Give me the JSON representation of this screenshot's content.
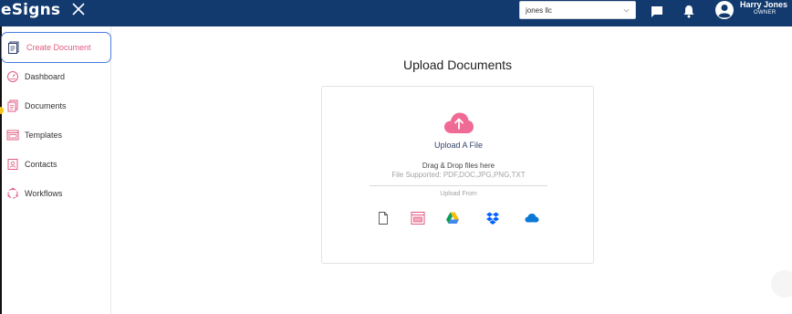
{
  "header": {
    "logo": "eSigns",
    "company": "jones llc",
    "user_name": "Harry Jones",
    "user_role": "OWNER"
  },
  "sidebar": {
    "items": [
      {
        "label": "Create Document",
        "icon": "create-document-icon",
        "active": true
      },
      {
        "label": "Dashboard",
        "icon": "dashboard-icon"
      },
      {
        "label": "Documents",
        "icon": "documents-icon"
      },
      {
        "label": "Templates",
        "icon": "templates-icon"
      },
      {
        "label": "Contacts",
        "icon": "contacts-icon"
      },
      {
        "label": "Workflows",
        "icon": "workflows-icon"
      }
    ]
  },
  "main": {
    "title": "Upload Documents",
    "upload_label": "Upload A File",
    "drag_drop": "Drag & Drop files here",
    "supported": "File Supported: PDF,DOC,JPG,PNG,TXT",
    "upload_from": "Upload From",
    "sources": [
      "file-icon",
      "templates-icon",
      "google-drive-icon",
      "dropbox-icon",
      "onedrive-icon"
    ]
  },
  "colors": {
    "header_bg": "#123a6e",
    "accent_pink": "#e05b7f",
    "active_border": "#4a7de0"
  }
}
